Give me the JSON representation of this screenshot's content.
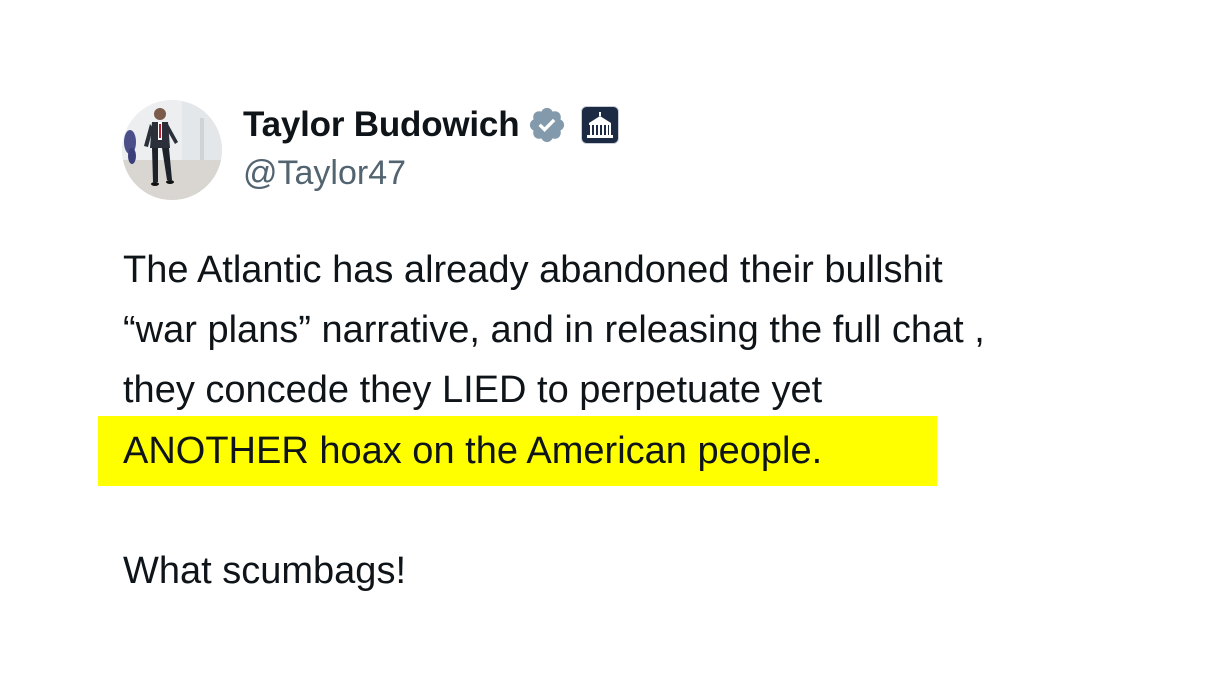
{
  "tweet": {
    "author": {
      "display_name": "Taylor Budowich",
      "handle": "@Taylor47",
      "avatar": "avatar-photo",
      "verified_icon": "verified-badge-icon",
      "affiliation_icon": "white-house-affiliate-icon",
      "verified_color": "#829aab"
    },
    "body_lines": [
      "The Atlantic has already abandoned their bullshit",
      "“war plans” narrative, and in releasing the full chat ,",
      "they concede they LIED to perpetuate yet"
    ],
    "highlighted_line": "ANOTHER hoax on the American people.",
    "highlight_color": "#ffff00",
    "closing_line": "What scumbags!"
  }
}
